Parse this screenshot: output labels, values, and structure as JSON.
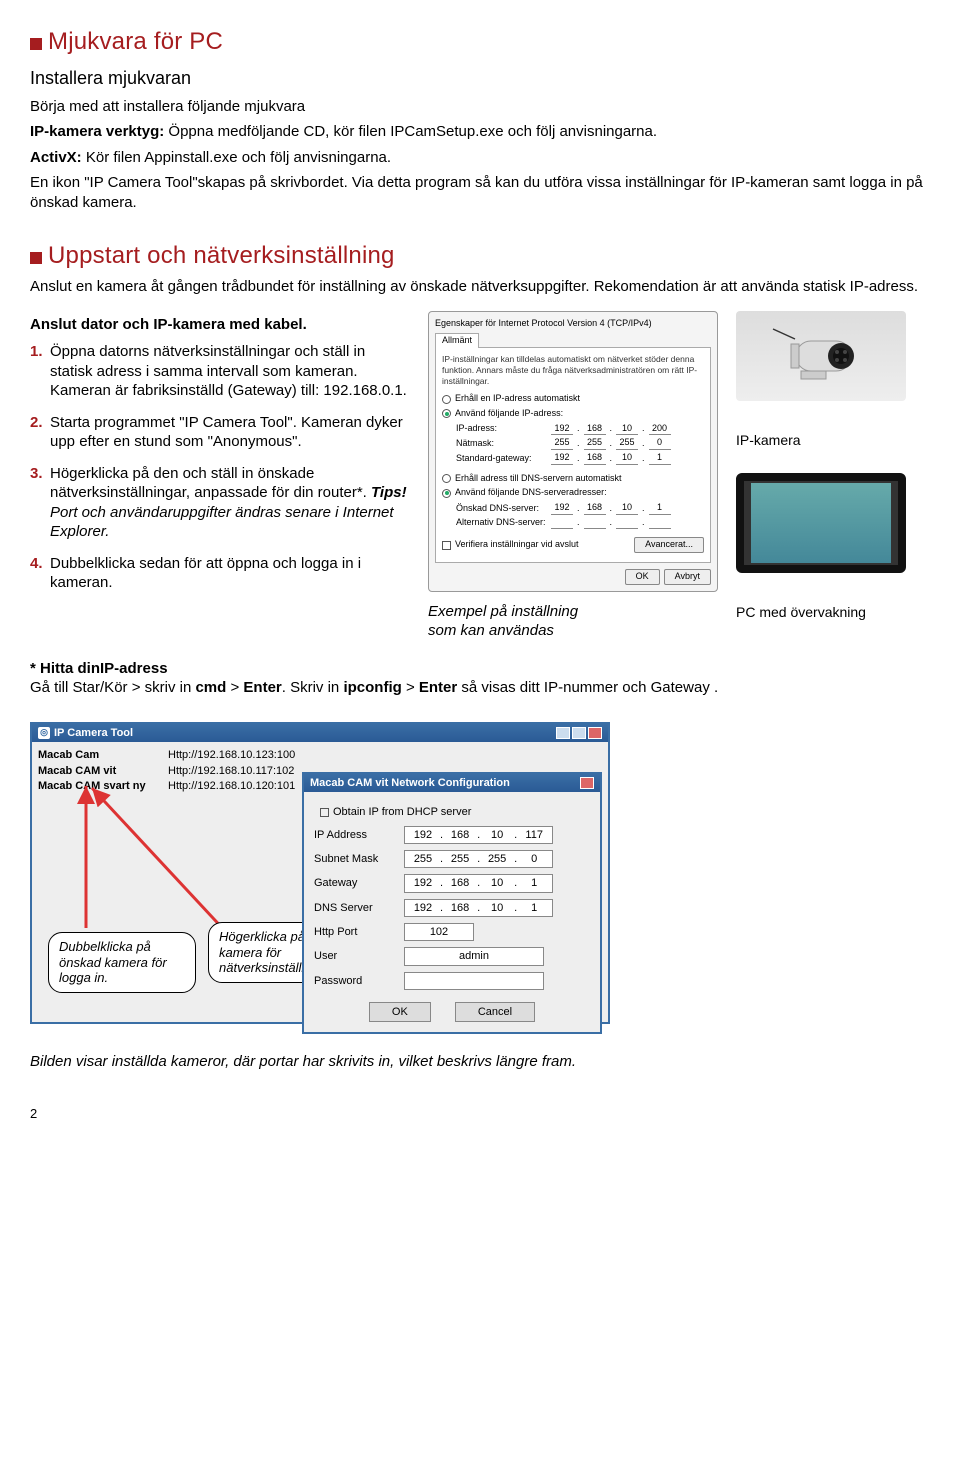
{
  "h1": "Mjukvara för PC",
  "sub1": "Installera mjukvaran",
  "p1": "Börja med att installera följande mjukvara",
  "p2a": "IP-kamera verktyg:",
  "p2b": " Öppna medföljande CD, kör filen IPCamSetup.exe och följ anvisningarna.",
  "p3a": "ActivX:",
  "p3b": " Kör filen Appinstall.exe och följ anvisningarna.",
  "p4": "En ikon \"IP Camera Tool\"skapas på skrivbordet. Via detta program så kan du utföra vissa inställningar för IP-kameran samt logga in på önskad kamera.",
  "h2": "Uppstart och nätverksinställning",
  "p5": "Anslut en kamera åt gången trådbundet för inställning av önskade nätverksuppgifter. Rekomendation är att använda statisk IP-adress.",
  "sub2": "Anslut dator och IP-kamera med kabel.",
  "steps": {
    "n1": "1.",
    "t1": "Öppna datorns nätverksinställningar och ställ in statisk adress i samma intervall som kameran. Kameran är fabriksinställd (Gateway) till: 192.168.0.1.",
    "n2": "2.",
    "t2": "Starta programmet \"IP Camera Tool\". Kameran dyker upp efter en stund som \"Anonymous\".",
    "n3": "3.",
    "t3a": "Högerklicka på den och ställ in önskade nätverksinställningar, anpassade för din router*.",
    "t3b": "Tips!",
    "t3c": " Port och användaruppgifter ändras senare i Internet Explorer.",
    "n4": "4.",
    "t4": "Dubbelklicka sedan för att öppna och logga in i kameran."
  },
  "dlg": {
    "title": "Egenskaper för Internet Protocol Version 4 (TCP/IPv4)",
    "tab": "Allmänt",
    "desc": "IP-inställningar kan tilldelas automatiskt om nätverket stöder denna funktion. Annars måste du fråga nätverksadministratören om rätt IP-inställningar.",
    "r1": "Erhåll en IP-adress automatiskt",
    "r2": "Använd följande IP-adress:",
    "ip_lbl": "IP-adress:",
    "ip": [
      "192",
      "168",
      "10",
      "200"
    ],
    "mask_lbl": "Nätmask:",
    "mask": [
      "255",
      "255",
      "255",
      "0"
    ],
    "gw_lbl": "Standard-gateway:",
    "gw": [
      "192",
      "168",
      "10",
      "1"
    ],
    "r3": "Erhåll adress till DNS-servern automatiskt",
    "r4": "Använd följande DNS-serveradresser:",
    "dns1_lbl": "Önskad DNS-server:",
    "dns1": [
      "192",
      "168",
      "10",
      "1"
    ],
    "dns2_lbl": "Alternativ DNS-server:",
    "chk": "Verifiera inställningar vid avslut",
    "adv": "Avancerat...",
    "ok": "OK",
    "cancel": "Avbryt"
  },
  "caption1a": "Exempel på inställning",
  "caption1b": "som kan användas",
  "label_cam": "IP-kamera",
  "label_pc": "PC med övervakning",
  "hitta_h": "* Hitta dinIP-adress",
  "hitta_a": "Gå till Star/Kör > skriv in ",
  "hitta_b": "cmd",
  "hitta_c": " > ",
  "hitta_d": "Enter",
  "hitta_e": ". Skriv in ",
  "hitta_f": "ipconfig",
  "hitta_g": "Enter",
  "hitta_h2": " så visas ditt IP-nummer och Gateway .",
  "tool": {
    "title": "IP Camera Tool",
    "rows": [
      {
        "name": "Macab Cam",
        "url": "Http://192.168.10.123:100"
      },
      {
        "name": "Macab CAM vit",
        "url": "Http://192.168.10.117:102"
      },
      {
        "name": "Macab CAM svart ny",
        "url": "Http://192.168.10.120:101"
      }
    ]
  },
  "cfg": {
    "title": "Macab CAM vit Network Configuration",
    "dhcp": "Obtain IP from DHCP server",
    "ip_lbl": "IP Address",
    "ip": [
      "192",
      "168",
      "10",
      "117"
    ],
    "sm_lbl": "Subnet Mask",
    "sm": [
      "255",
      "255",
      "255",
      "0"
    ],
    "gw_lbl": "Gateway",
    "gw": [
      "192",
      "168",
      "10",
      "1"
    ],
    "dns_lbl": "DNS Server",
    "dns": [
      "192",
      "168",
      "10",
      "1"
    ],
    "port_lbl": "Http Port",
    "port": "102",
    "user_lbl": "User",
    "user": "admin",
    "pwd_lbl": "Password",
    "ok": "OK",
    "cancel": "Cancel"
  },
  "bubble1": "Dubbelklicka på önskad kamera för logga in.",
  "bubble2": "Högerklicka på önskad kamera för nätverksinställningar.",
  "end": "Bilden visar inställda kameror, där portar har skrivits in, vilket  beskrivs längre fram.",
  "pagenum": "2"
}
